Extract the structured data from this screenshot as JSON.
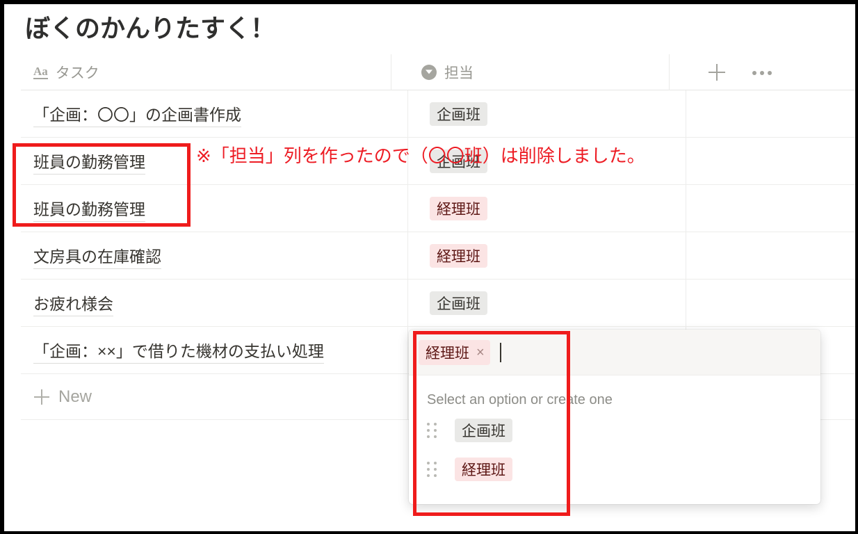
{
  "page": {
    "title": "ぼくのかんりたすく！"
  },
  "table": {
    "columns": [
      {
        "label": "タスク",
        "icon": "text-type-icon"
      },
      {
        "label": "担当",
        "icon": "select-type-icon"
      }
    ],
    "header_actions": {
      "add_property": "+",
      "more_options": "•••"
    },
    "rows": [
      {
        "task": "「企画：〇〇」の企画書作成",
        "tag": "企画班",
        "tag_color": "gray"
      },
      {
        "task": "班員の勤務管理",
        "tag": "企画班",
        "tag_color": "gray"
      },
      {
        "task": "班員の勤務管理",
        "tag": "経理班",
        "tag_color": "red"
      },
      {
        "task": "文房具の在庫確認",
        "tag": "経理班",
        "tag_color": "red"
      },
      {
        "task": "お疲れ様会",
        "tag": "企画班",
        "tag_color": "gray"
      },
      {
        "task": "「企画：××」で借りた機材の支払い処理",
        "tag": "経理班",
        "tag_color": "red"
      }
    ],
    "new_row_label": "New"
  },
  "popup": {
    "selected_tag": "経理班",
    "remove_icon": "×",
    "hint": "Select an option or create one",
    "options": [
      {
        "label": "企画班",
        "color": "gray"
      },
      {
        "label": "経理班",
        "color": "red"
      }
    ]
  },
  "annotation": {
    "text": "※「担当」列を作ったので（〇〇班）は削除しました。",
    "color": "#ed1c24"
  },
  "colors": {
    "tag_gray_bg": "#e9e9e7",
    "tag_gray_text": "#373530",
    "tag_red_bg": "#fbe4e4",
    "tag_red_text": "#5d1715",
    "annotation_red": "#ed1c24",
    "text_primary": "#37352f",
    "text_muted": "#989892"
  }
}
